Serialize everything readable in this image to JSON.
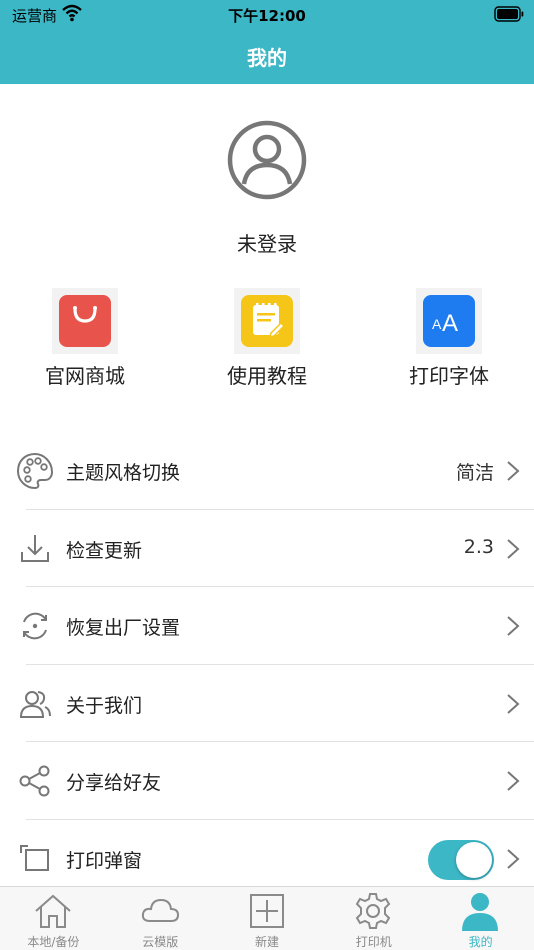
{
  "status_bar": {
    "carrier": "运营商",
    "time": "下午12:00"
  },
  "header": {
    "title": "我的"
  },
  "profile": {
    "login_status": "未登录"
  },
  "quick_actions": [
    {
      "label": "官网商城",
      "icon": "shopping-bag-icon",
      "color": "#e8534c"
    },
    {
      "label": "使用教程",
      "icon": "notepad-icon",
      "color": "#f5c518"
    },
    {
      "label": "打印字体",
      "icon": "font-size-icon",
      "color": "#1e7cf0"
    }
  ],
  "menu": [
    {
      "label": "主题风格切换",
      "value": "简洁",
      "icon": "palette-icon"
    },
    {
      "label": "检查更新",
      "value": "2.3",
      "icon": "download-icon"
    },
    {
      "label": "恢复出厂设置",
      "value": "",
      "icon": "reset-icon"
    },
    {
      "label": "关于我们",
      "value": "",
      "icon": "users-icon"
    },
    {
      "label": "分享给好友",
      "value": "",
      "icon": "share-icon"
    },
    {
      "label": "打印弹窗",
      "value": "",
      "icon": "popup-icon",
      "toggle_on": true
    }
  ],
  "tabs": [
    {
      "label": "本地/备份",
      "icon": "home-icon"
    },
    {
      "label": "云模版",
      "icon": "cloud-icon"
    },
    {
      "label": "新建",
      "icon": "add-icon"
    },
    {
      "label": "打印机",
      "icon": "printer-settings-icon"
    },
    {
      "label": "我的",
      "icon": "profile-icon",
      "active": true
    }
  ],
  "colors": {
    "accent": "#3cb7c6",
    "text": "#222222",
    "tab_inactive": "#8a8a8a"
  }
}
